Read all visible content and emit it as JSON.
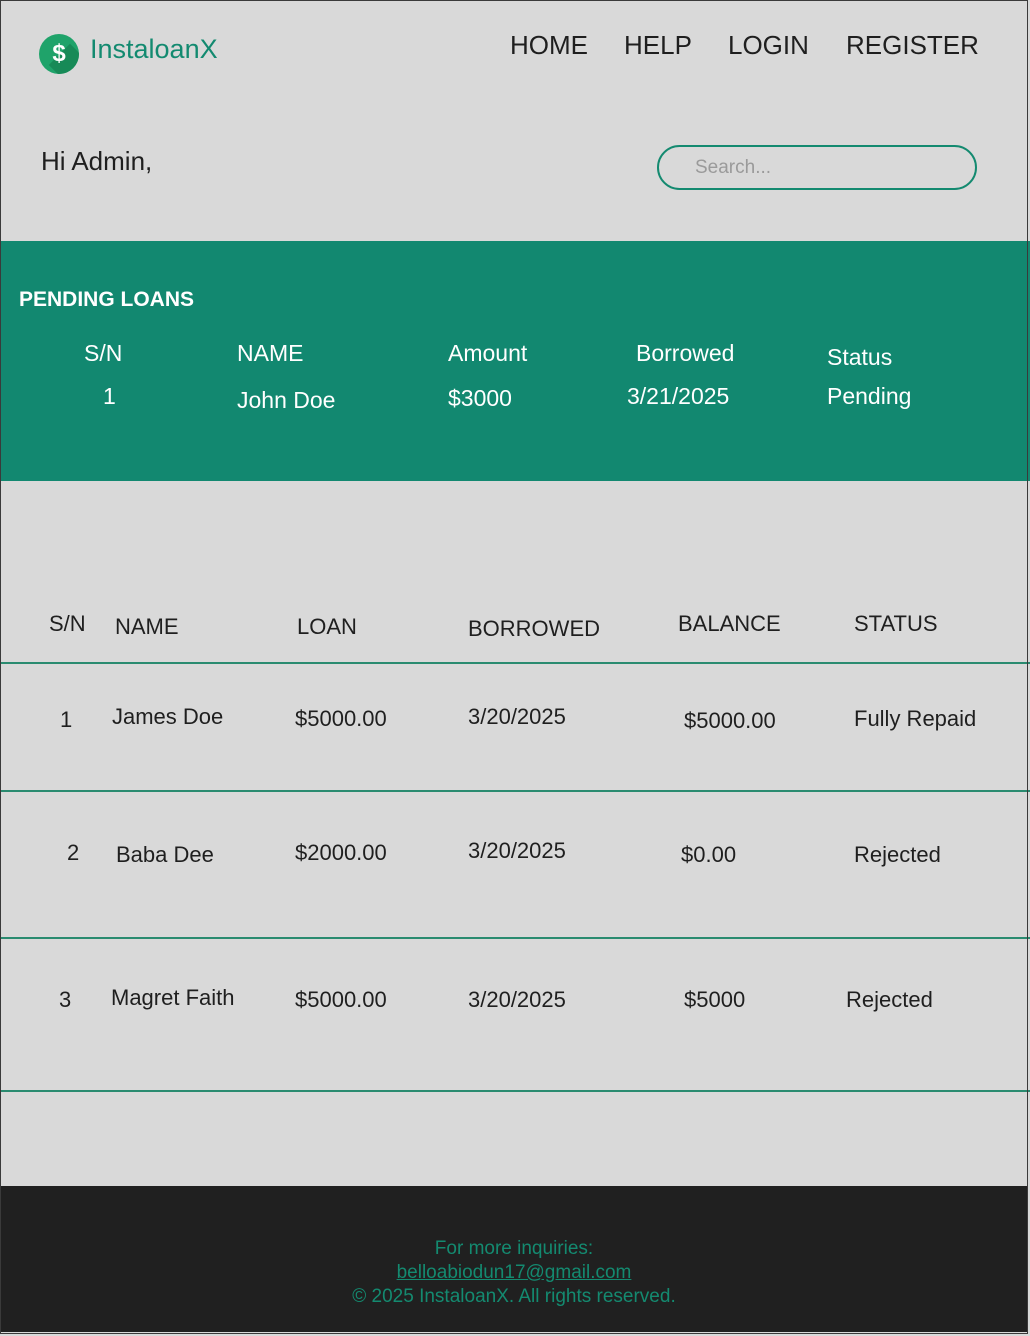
{
  "app": {
    "brand": "InstaloanX",
    "logo_icon": "dollar-coin-icon",
    "accent": "#128870"
  },
  "nav": {
    "home": "HOME",
    "help": "HELP",
    "login": "LOGIN",
    "register": "REGISTER"
  },
  "greeting": "Hi Admin,",
  "search": {
    "placeholder": "Search...",
    "value": ""
  },
  "pending": {
    "title": "PENDING LOANS",
    "headers": {
      "sn": "S/N",
      "name": "NAME",
      "amount": "Amount",
      "borrowed": "Borrowed",
      "status": "Status"
    },
    "rows": [
      {
        "sn": "1",
        "name": "John Doe",
        "amount": "$3000",
        "borrowed": "3/21/2025",
        "status": "Pending"
      }
    ]
  },
  "loans": {
    "headers": {
      "sn": "S/N",
      "name": "NAME",
      "loan": "LOAN",
      "borrowed": "BORROWED",
      "balance": "BALANCE",
      "status": "STATUS"
    },
    "rows": [
      {
        "sn": "1",
        "name": "James Doe",
        "loan": "$5000.00",
        "borrowed": "3/20/2025",
        "balance": "$5000.00",
        "status": "Fully Repaid"
      },
      {
        "sn": "2",
        "name": "Baba Dee",
        "loan": "$2000.00",
        "borrowed": "3/20/2025",
        "balance": "$0.00",
        "status": "Rejected"
      },
      {
        "sn": "3",
        "name": "Magret Faith",
        "loan": "$5000.00",
        "borrowed": "3/20/2025",
        "balance": "$5000",
        "status": "Rejected"
      }
    ]
  },
  "footer": {
    "inquiries": "For more inquiries:",
    "email": "belloabiodun17@gmail.com",
    "copyright": "© 2025 InstaloanX. All rights reserved."
  }
}
